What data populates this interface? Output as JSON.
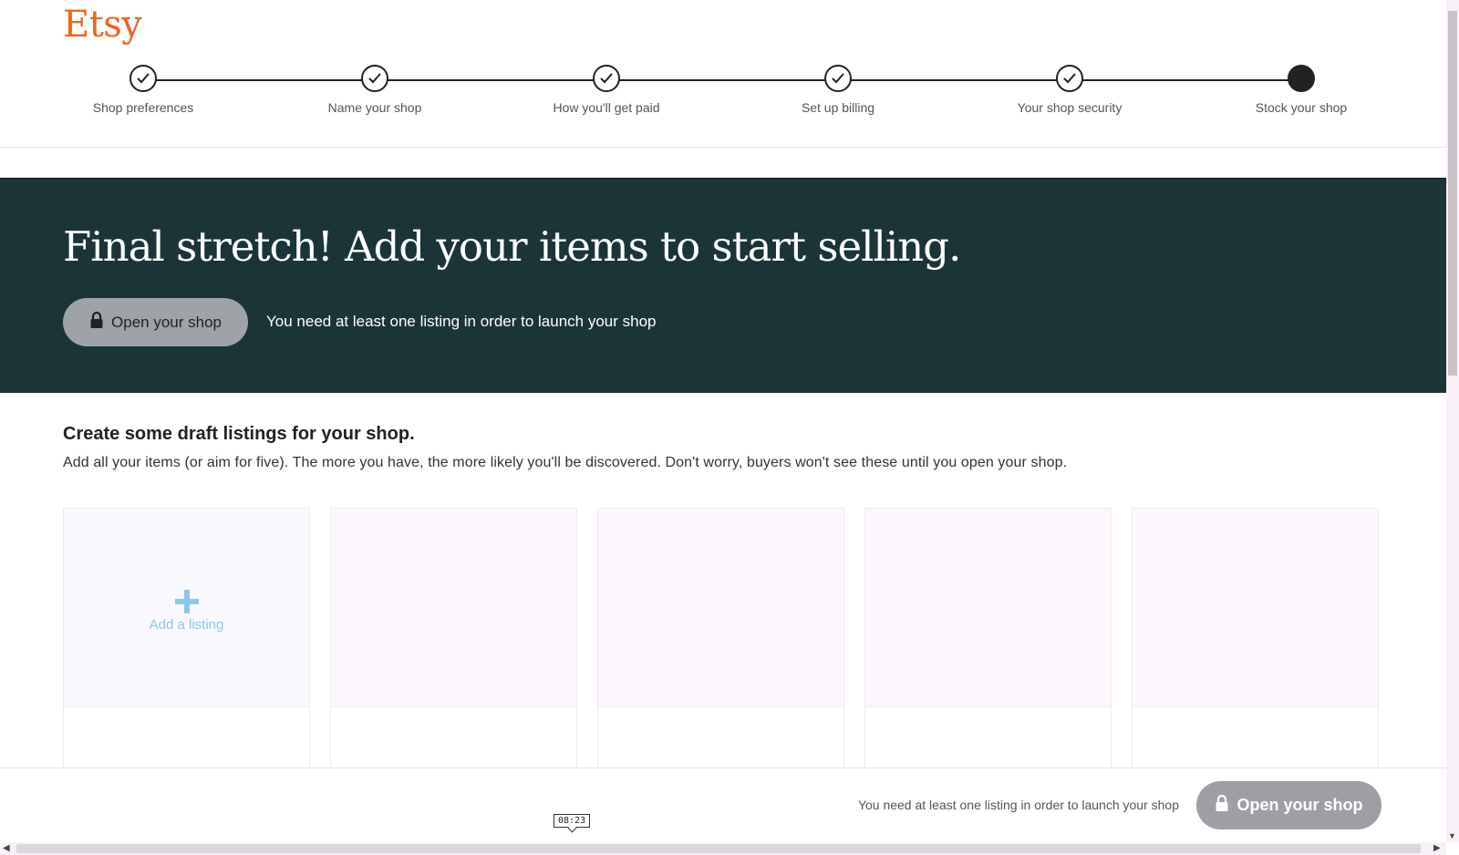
{
  "brand": {
    "logo_text": "Etsy",
    "color": "#f1641e"
  },
  "stepper": {
    "steps": [
      {
        "label": "Shop preferences",
        "status": "complete"
      },
      {
        "label": "Name your shop",
        "status": "complete"
      },
      {
        "label": "How you'll get paid",
        "status": "complete"
      },
      {
        "label": "Set up billing",
        "status": "complete"
      },
      {
        "label": "Your shop security",
        "status": "complete"
      },
      {
        "label": "Stock your shop",
        "status": "current"
      }
    ]
  },
  "hero": {
    "title": "Final stretch! Add your items to start selling.",
    "open_shop_label": "Open your shop",
    "note": "You need at least one listing in order to launch your shop",
    "background": "#1b3438"
  },
  "drafts": {
    "title": "Create some draft listings for your shop.",
    "description": "Add all your items (or aim for five). The more you have, the more likely you'll be discovered. Don't worry, buyers won't see these until you open your shop.",
    "add_listing_label": "Add a listing",
    "placeholder_count": 4
  },
  "bottom_bar": {
    "note": "You need at least one listing in order to launch your shop",
    "open_shop_label": "Open your shop"
  },
  "player": {
    "timestamp": "08:23"
  }
}
